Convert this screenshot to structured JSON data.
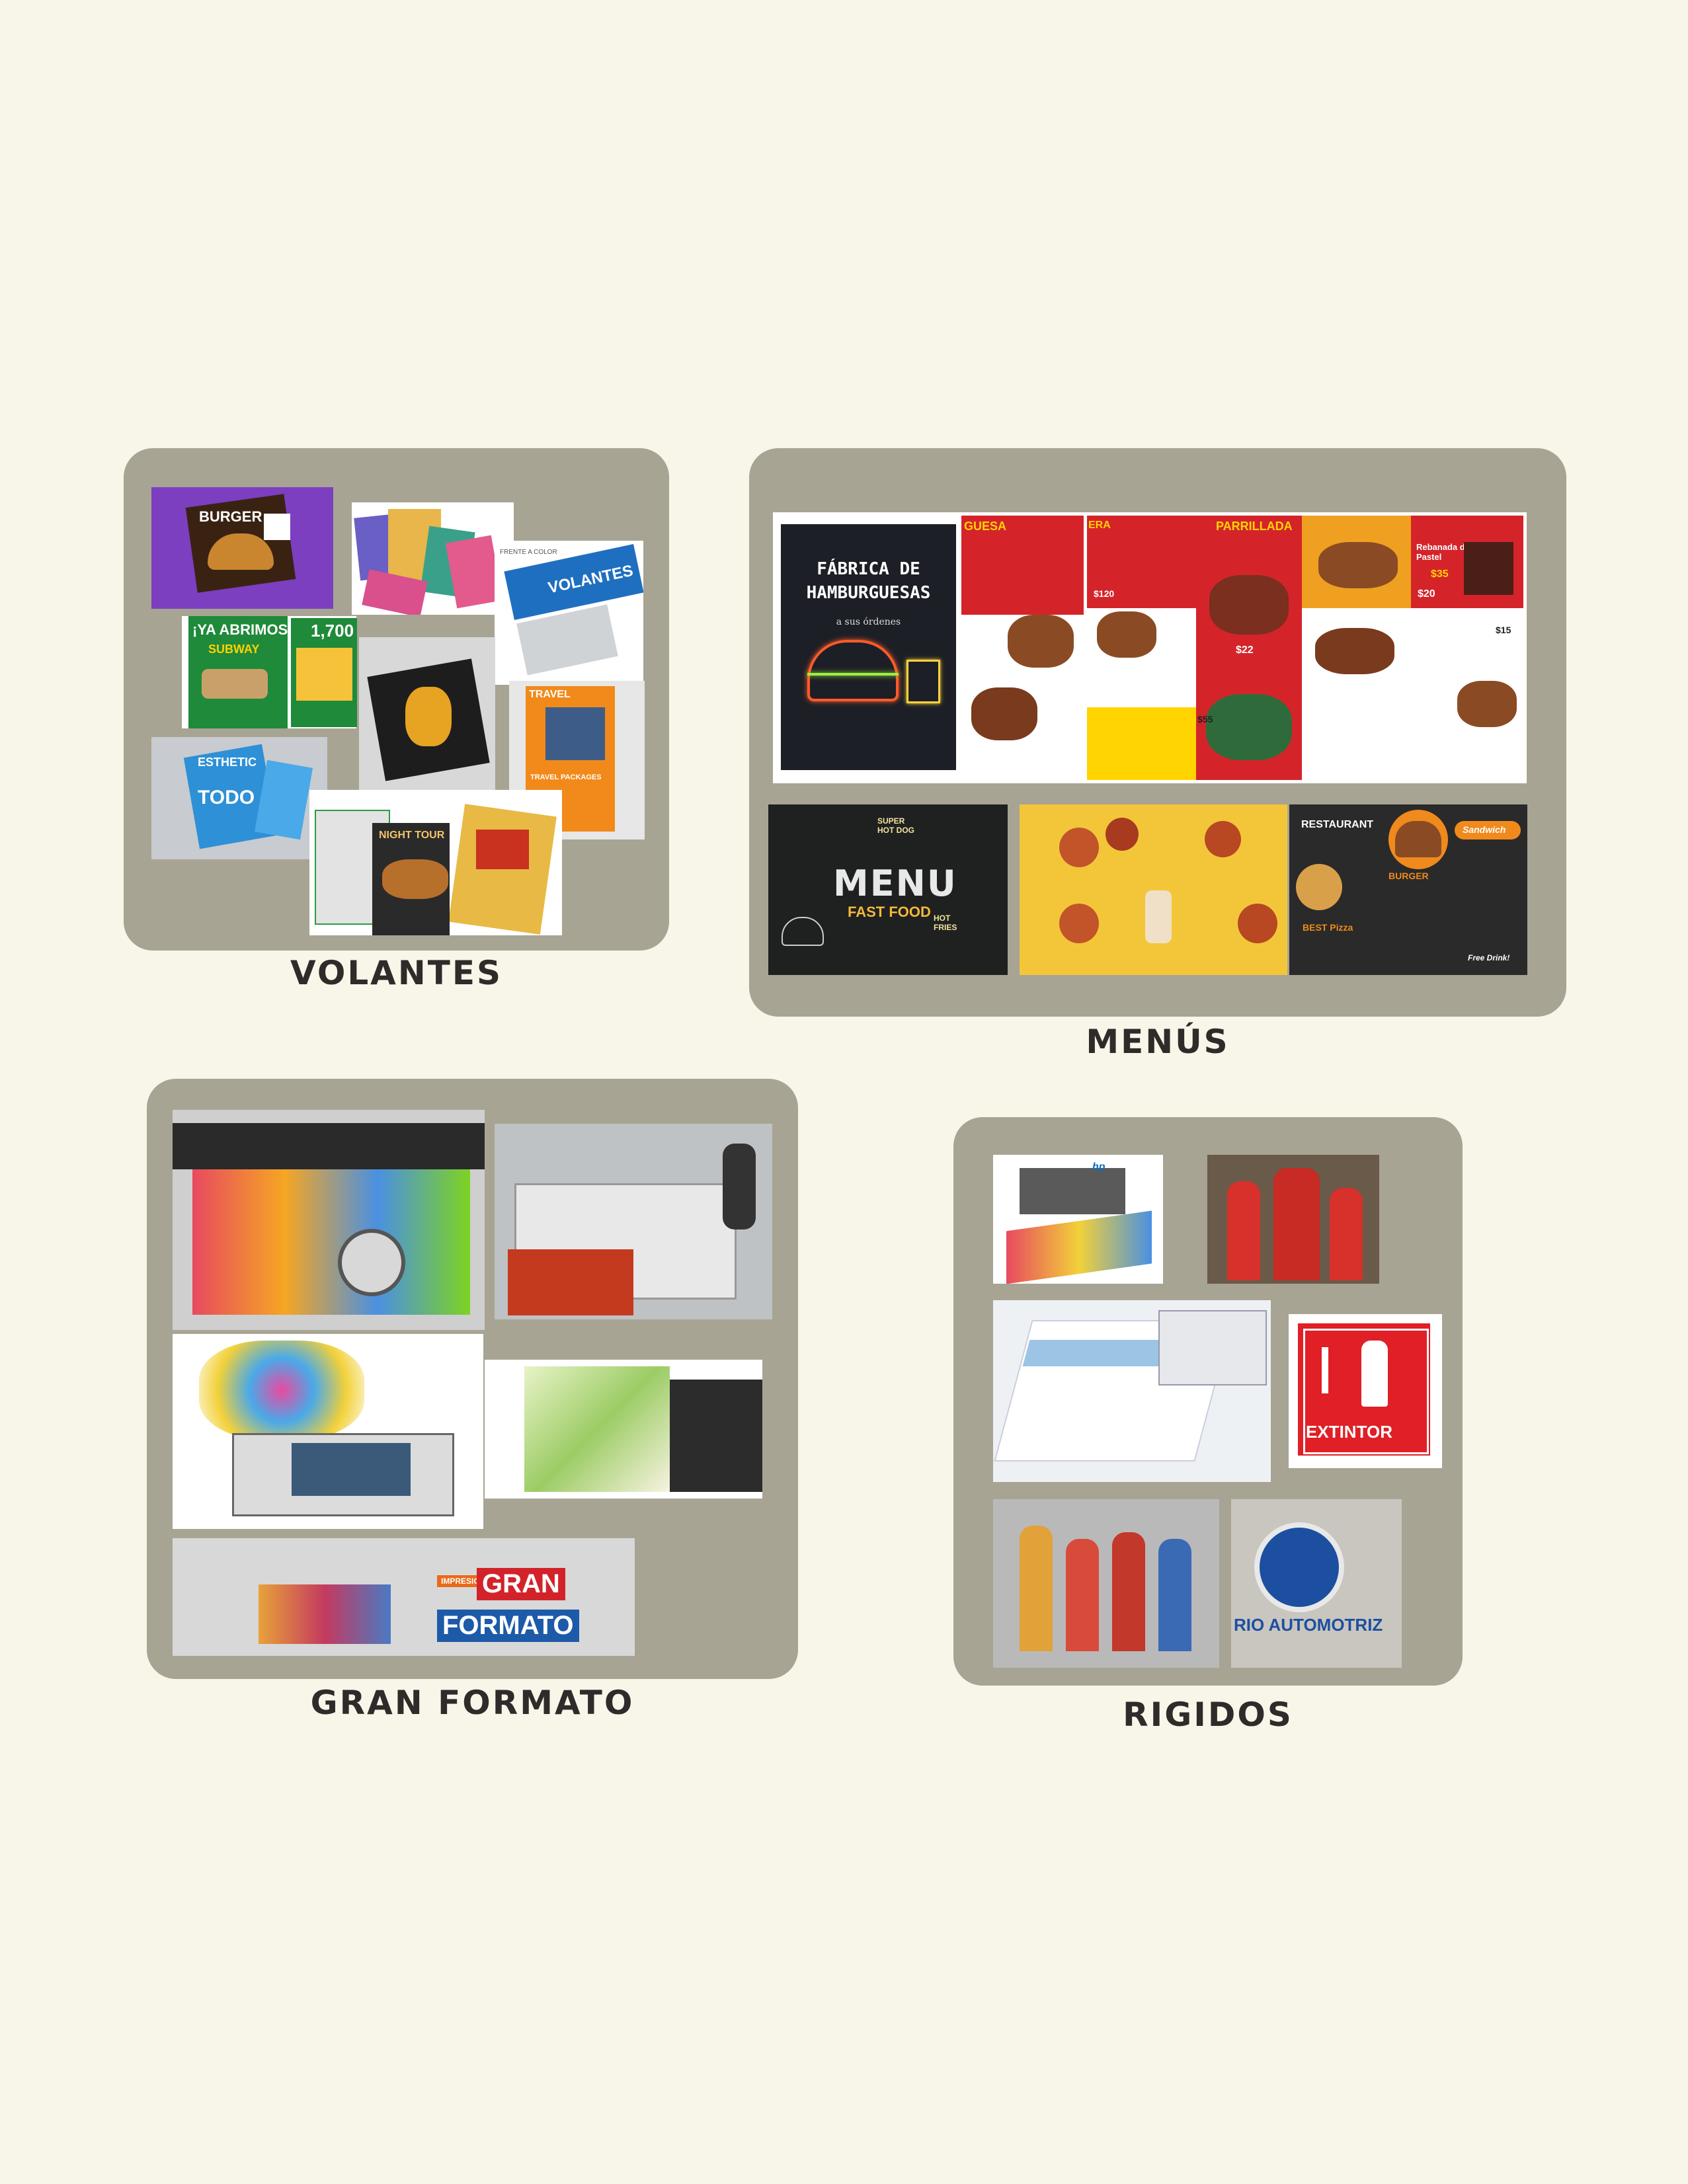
{
  "sections": {
    "volantes": {
      "caption": "VOLANTES",
      "thumbs": {
        "burger": "BURGER",
        "subway": "¡YA ABRIMOS!",
        "subway_sub": "SUBWAY",
        "price": "1,700",
        "front_color": "FRENTE A COLOR",
        "volantes": "VOLANTES",
        "esthetic": "ESTHETIC",
        "todo": "TODO",
        "travel": "TRAVEL",
        "travel_packages": "TRAVEL PACKAGES",
        "night_tour": "NIGHT TOUR"
      }
    },
    "menus": {
      "caption": "MENÚS",
      "hamburger_title": "FÁBRICA DE HAMBURGUESAS",
      "hamburger_sub": "a sus órdenes",
      "panel_heads": [
        "GUESA",
        "ERA",
        "PARRILLADA",
        "",
        "Rebanada de Pastel"
      ],
      "prices": [
        "$120",
        "$22",
        "$55",
        "$35",
        "$20",
        "$15"
      ],
      "board_menu": "MENU",
      "board_fast": "FAST FOOD",
      "board_super": "SUPER HOT DOG",
      "board_hot": "HOT FRIES",
      "restaurant": "RESTAURANT",
      "burger": "BURGER",
      "sandwich": "Sandwich",
      "best_pizza": "BEST Pizza",
      "free_drink": "Free Drink!"
    },
    "gran_formato": {
      "caption": "GRAN FORMATO",
      "logo_top": "IMPRESION",
      "logo_gran": "GRAN",
      "logo_formato": "FORMATO"
    },
    "rigidos": {
      "caption": "RIGIDOS",
      "hp": "hp",
      "extintor": "EXTINTOR",
      "vw_text": "RIO AUTOMOTRIZ"
    }
  }
}
